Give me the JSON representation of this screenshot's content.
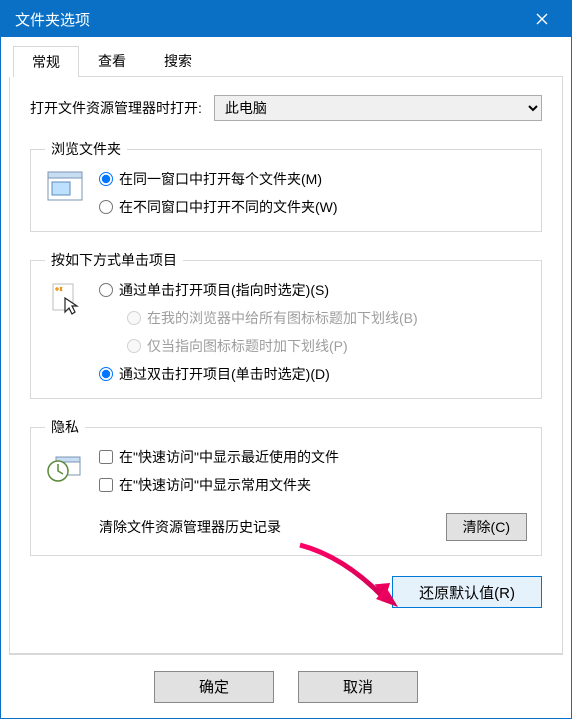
{
  "title": "文件夹选项",
  "tabs": {
    "general": "常规",
    "view": "查看",
    "search": "搜索"
  },
  "open_with": {
    "label": "打开文件资源管理器时打开:",
    "selected": "此电脑"
  },
  "browse": {
    "legend": "浏览文件夹",
    "opt_same": "在同一窗口中打开每个文件夹(M)",
    "opt_new": "在不同窗口中打开不同的文件夹(W)"
  },
  "click": {
    "legend": "按如下方式单击项目",
    "opt_single": "通过单击打开项目(指向时选定)(S)",
    "sub_underline_all": "在我的浏览器中给所有图标标题加下划线(B)",
    "sub_underline_point": "仅当指向图标标题时加下划线(P)",
    "opt_double": "通过双击打开项目(单击时选定)(D)"
  },
  "privacy": {
    "legend": "隐私",
    "chk_recent": "在\"快速访问\"中显示最近使用的文件",
    "chk_frequent": "在\"快速访问\"中显示常用文件夹",
    "clear_label": "清除文件资源管理器历史记录",
    "clear_btn": "清除(C)"
  },
  "restore_btn": "还原默认值(R)",
  "footer": {
    "ok": "确定",
    "cancel": "取消"
  }
}
